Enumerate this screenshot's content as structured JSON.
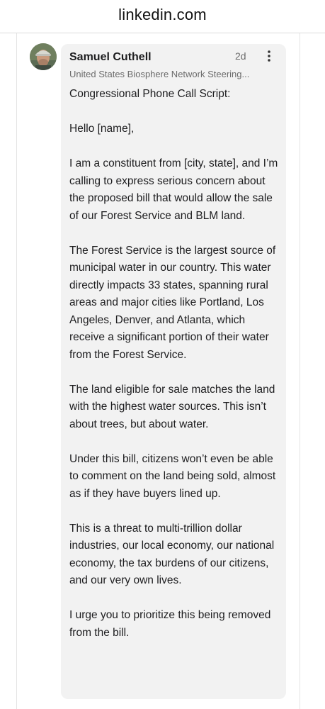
{
  "browser": {
    "domain": "linkedin.com"
  },
  "comment": {
    "author_name": "Samuel Cuthell",
    "timestamp": "2d",
    "author_headline": "United States Biosphere Network Steering...",
    "more_icon": "vertical-ellipsis-icon",
    "body": [
      "Congressional Phone Call Script:",
      "Hello [name],",
      "I am a constituent from [city, state], and I’m calling to express serious concern about the proposed bill that would allow the sale of our Forest Service and BLM land.",
      "The Forest Service is the largest source of municipal water in our country. This water directly impacts 33 states, spanning rural areas and major cities like Portland, Los Angeles, Denver, and Atlanta, which receive a significant portion of their water from the Forest Service.",
      "The land eligible for sale matches the land with the highest water sources. This isn’t about trees, but about water.",
      "Under this bill, citizens won’t even be able to comment on the land being sold, almost as if they have buyers lined up.",
      "This is a threat to multi-trillion dollar industries, our local economy, our national economy, the tax burdens of our citizens, and our very own lives.",
      "I urge you to prioritize this being removed from the bill."
    ]
  }
}
